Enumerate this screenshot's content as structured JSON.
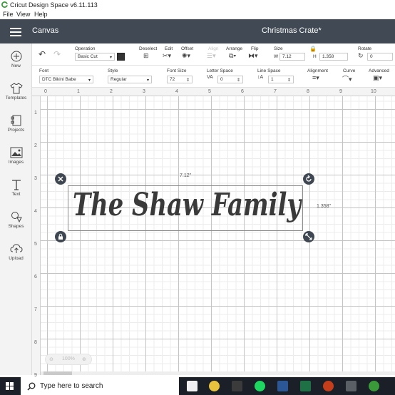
{
  "window": {
    "title": "Cricut Design Space  v6.11.113"
  },
  "menu": [
    "File",
    "View",
    "Help"
  ],
  "appbar": {
    "section": "Canvas",
    "project_name": "Christmas Crate*"
  },
  "sidebar": {
    "items": [
      {
        "label": "New",
        "icon": "plus-circle-icon"
      },
      {
        "label": "Templates",
        "icon": "shirt-icon"
      },
      {
        "label": "Projects",
        "icon": "projects-icon"
      },
      {
        "label": "Images",
        "icon": "image-icon"
      },
      {
        "label": "Text",
        "icon": "text-icon"
      },
      {
        "label": "Shapes",
        "icon": "shapes-icon"
      },
      {
        "label": "Upload",
        "icon": "upload-icon"
      }
    ]
  },
  "toolbar": {
    "operation_label": "Operation",
    "operation_value": "Basic Cut",
    "deselect_label": "Deselect",
    "edit_label": "Edit",
    "offset_label": "Offset",
    "align_label": "Align",
    "arrange_label": "Arrange",
    "flip_label": "Flip",
    "size_label": "Size",
    "w_label": "W",
    "w_value": "7.12",
    "h_label": "H",
    "h_value": "1.358",
    "rotate_label": "Rotate",
    "rotate_value": "0",
    "swatch_color": "#333333"
  },
  "text_toolbar": {
    "font_label": "Font",
    "font_value": "DTC Bikini Babe",
    "style_label": "Style",
    "style_value": "Regular",
    "font_size_label": "Font Size",
    "font_size_value": "72",
    "letter_space_label": "Letter Space",
    "letter_space_value": "0",
    "line_space_label": "Line Space",
    "line_space_value": "1",
    "alignment_label": "Alignment",
    "curve_label": "Curve",
    "advanced_label": "Advanced"
  },
  "ruler": {
    "top": [
      "0",
      "1",
      "2",
      "3",
      "4",
      "5",
      "6",
      "7",
      "8",
      "9",
      "10"
    ],
    "left": [
      "1",
      "2",
      "3",
      "4",
      "5",
      "6",
      "7",
      "8",
      "9"
    ]
  },
  "canvas": {
    "text": "The Shaw Family",
    "text_color": "#3a3a3a",
    "width_dim": "7.12\"",
    "height_dim": "1.358\""
  },
  "zoom": {
    "value": "100%"
  },
  "taskbar": {
    "search_placeholder": "Type here to search"
  }
}
